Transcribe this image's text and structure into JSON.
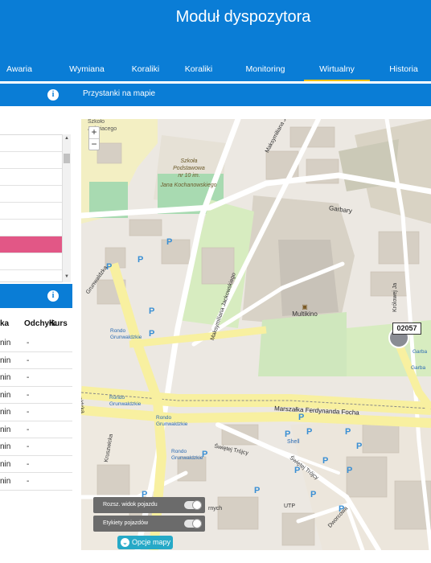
{
  "header": {
    "title": "Moduł dyspozytora"
  },
  "nav": {
    "tabs": [
      {
        "label": "Awaria"
      },
      {
        "label": "Wymiana"
      },
      {
        "label": "Koraliki"
      },
      {
        "label": "Koraliki"
      },
      {
        "label": "Monitoring"
      },
      {
        "label": "Wirtualny"
      },
      {
        "label": "Historia"
      }
    ],
    "active": "Wirtualny"
  },
  "subnav": {
    "title": "Przystanki na mapie",
    "info_icon": "i"
  },
  "vehicles_panel": {
    "info_icon": "i",
    "columns": [
      "ka",
      "Odchyłk",
      "Kurs"
    ],
    "rows": [
      {
        "time": "nin",
        "deviation": "-"
      },
      {
        "time": "nin",
        "deviation": "-"
      },
      {
        "time": "nin",
        "deviation": "-"
      },
      {
        "time": "nin",
        "deviation": "-"
      },
      {
        "time": "nin",
        "deviation": "-"
      },
      {
        "time": "nin",
        "deviation": "-"
      },
      {
        "time": "nin",
        "deviation": "-"
      },
      {
        "time": "nin",
        "deviation": "-"
      },
      {
        "time": "nin",
        "deviation": "-"
      }
    ]
  },
  "map": {
    "zoom_in": "+",
    "zoom_out": "−",
    "vehicle_label": "02057",
    "labels": {
      "school_top": "Szkoło",
      "school_top2": "Jyświacego",
      "school": "Szkoła",
      "school2": "Podstawowa",
      "school3": "nr 10 im.",
      "school4": "Jana Kochanowskiego",
      "maksymiliana1": "Maksymiliana Jackowskiego",
      "maksymiliana2": "Maksymiliana Jackowskiego",
      "garbary": "Garbary",
      "multikino": "Multikino",
      "krolowej": "Królowej Ja",
      "grunwaldzka": "Grunwaldzka",
      "rondo1": "Rondo",
      "rondo1b": "Grunwaldzkie",
      "rondo2": "Rondo",
      "rondo2b": "Grunwaldzkie",
      "rondo3": "Rondo",
      "rondo3b": "Grunwaldzkie",
      "rondo4": "Rondo",
      "rondo4b": "Grunwaldzkie",
      "focha": "Marszałka Ferdynanda Focha",
      "swietej": "Świętej Trójcy",
      "swietej2": "Świętej Trójcy",
      "kruszwicka": "Kruszwicka",
      "shell": "Shell",
      "garba1": "Garba",
      "garba2": "Garba",
      "utp": "UTP",
      "rnych": "rnych",
      "dwor": "Dworcowa"
    },
    "controls": {
      "extended_view": "Rozsz. widok pojazdu",
      "vehicle_labels": "Etykiety pojazdów",
      "map_options": "Opcje mapy"
    }
  },
  "colors": {
    "primary": "#0a7dd6",
    "accent": "#f2c200",
    "selected_row": "#e25786",
    "options_button": "#26a9c7"
  }
}
